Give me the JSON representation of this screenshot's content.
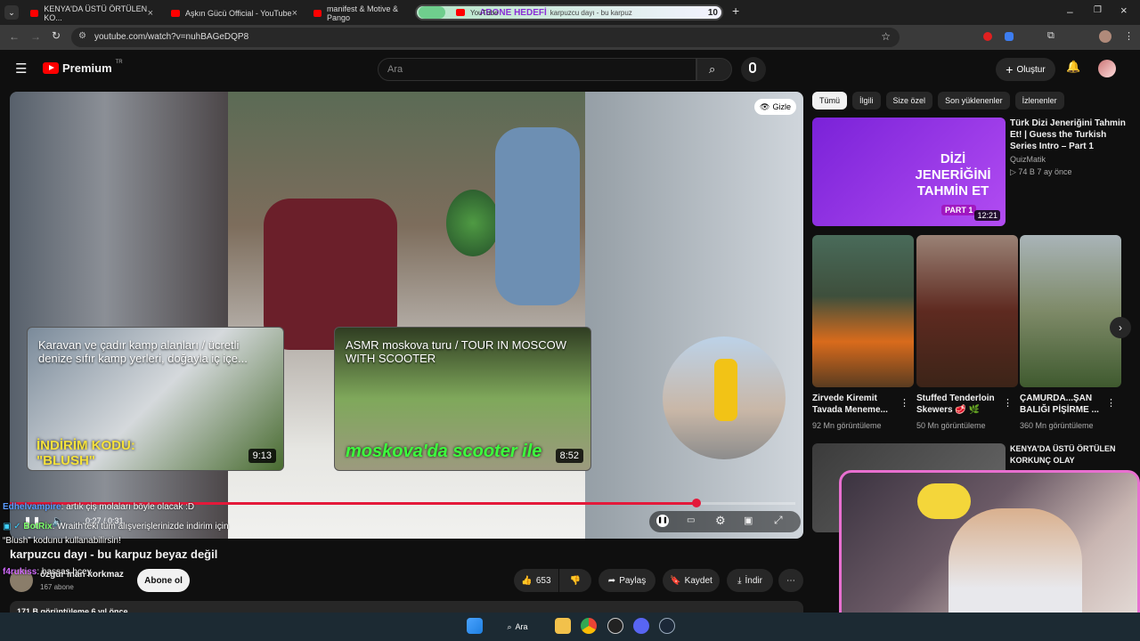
{
  "browser": {
    "tabs": [
      {
        "label": "KENYA'DA ÜSTÜ ÖRTÜLEN KO..."
      },
      {
        "label": "Aşkın Gücü Official - YouTube"
      },
      {
        "label": "manifest & Motive & Pango"
      },
      {
        "label": "YouTube"
      },
      {
        "label": "karpuzcu dayı - bu karpuz"
      }
    ],
    "url": "youtube.com/watch?v=nuhBAGeDQP8",
    "overlay_text": "ABONE HEDEFİ",
    "overlay_count": "10"
  },
  "youtube": {
    "logo": "Premium",
    "logo_sup": "TR",
    "search_placeholder": "Ara",
    "create_label": "Oluştur"
  },
  "player": {
    "hide_label": "Gizle",
    "time": "0:27 / 0:31",
    "progress_fraction": 0.87
  },
  "endcards": [
    {
      "title": "Karavan ve çadır kamp alanları / ücretli denize sıfır kamp yerleri, doğayla iç içe...",
      "duration": "9:13",
      "overlay": "İNDİRİM KODU: \"BLUSH\""
    },
    {
      "title": "ASMR moskova turu / TOUR IN MOSCOW WITH SCOOTER",
      "duration": "8:52",
      "overlay": "moskova'da scooter ile"
    }
  ],
  "video_info": {
    "title": "karpuzcu dayı - bu karpuz beyaz değil",
    "channel": "özgür inan korkmaz",
    "subs": "167 abone",
    "subscribe_label": "Abone ol",
    "likes": "653",
    "share_label": "Paylaş",
    "save_label": "Kaydet",
    "download_label": "İndir",
    "views": "171 B görüntüleme  6 yıl önce"
  },
  "chat": [
    {
      "user": "Edhelvampire",
      "text": ": artık çiş molaları böyle olacak :D"
    },
    {
      "user": "BotRix",
      "text": ": Wraith'teki tüm alışverişlerinizde indirim için “Blush” kodunu kullanabilirsin!"
    },
    {
      "user": "f4rukiss",
      "text": ": hassas hcey"
    }
  ],
  "sidebar": {
    "chips": [
      "Tümü",
      "İlgili",
      "Size özel",
      "Son yüklenenler",
      "İzlenenler"
    ],
    "top_video": {
      "title": "Türk Dizi Jeneriğini Tahmin Et! | Guess the Turkish Series Intro – Part 1",
      "channel": "QuizMatik",
      "meta": "▷ 74 B  7 ay önce",
      "thumb_text": "DİZİ JENERİĞİNİ TAHMİN ET",
      "thumb_part": "PART 1",
      "duration": "12:21"
    },
    "shorts": [
      {
        "title": "Zirvede Kiremit Tavada Meneme...",
        "views": "92 Mn görüntüleme"
      },
      {
        "title": "Stuffed Tenderloin Skewers 🥩 🌿",
        "views": "50 Mn görüntüleme"
      },
      {
        "title": "ÇAMURDA...ŞAN BALIĞI PİŞİRME ...",
        "views": "360 Mn görüntüleme"
      }
    ],
    "next_video": {
      "title": "KENYA'DA ÜSTÜ ÖRTÜLEN KORKUNÇ OLAY"
    }
  },
  "taskbar": {
    "search_label": "Ara"
  },
  "colors": {
    "accent": "#e4193a",
    "background": "#0f0f0f",
    "webcam_border": "#e86fd0"
  }
}
